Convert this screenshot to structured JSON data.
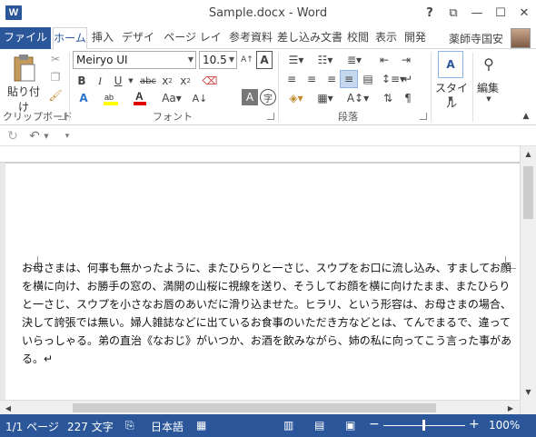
{
  "window": {
    "app_icon": "W",
    "title": "Sample.docx - Word",
    "buttons": [
      "?",
      "⧉",
      "—",
      "☐",
      "✕"
    ]
  },
  "tabs": [
    {
      "label": "ファイル"
    },
    {
      "label": "ホーム"
    },
    {
      "label": "挿入"
    },
    {
      "label": "デザイン"
    },
    {
      "label": "ページ レイアウ"
    },
    {
      "label": "参考資料"
    },
    {
      "label": "差し込み文書"
    },
    {
      "label": "校閲"
    },
    {
      "label": "表示"
    },
    {
      "label": "開発"
    }
  ],
  "user": {
    "name": "薬師寺国安"
  },
  "ribbon": {
    "clipboard": {
      "paste_label": "貼り付け",
      "group_label": "クリップボード"
    },
    "font": {
      "font_name": "Meiryo UI",
      "font_size": "10.5",
      "group_label": "フォント"
    },
    "paragraph": {
      "group_label": "段落"
    },
    "styles": {
      "label": "スタイル"
    },
    "editing": {
      "label": "編集"
    }
  },
  "document": {
    "text": "お母さまは、何事も無かったように、またひらりと一さじ、スウプをお口に流し込み、すましてお顔を横に向け、お勝手の窓の、満開の山桜に視線を送り、そうしてお顔を横に向けたまま、またひらりと一さじ、スウプを小さなお唇のあいだに滑り込ませた。ヒラリ、という形容は、お母さまの場合、決して誇張では無い。婦人雑誌などに出ているお食事のいただき方などとは、てんでまるで、違っていらっしゃる。弟の直治《なおじ》がいつか、お酒を飲みながら、姉の私に向ってこう言った事がある。↵"
  },
  "status": {
    "page": "1/1 ページ",
    "words": "227 文字",
    "language": "日本語",
    "zoom": "100%"
  },
  "colors": {
    "accent": "#2b579a",
    "highlight": "#ffff00",
    "font_color": "#e00000"
  }
}
